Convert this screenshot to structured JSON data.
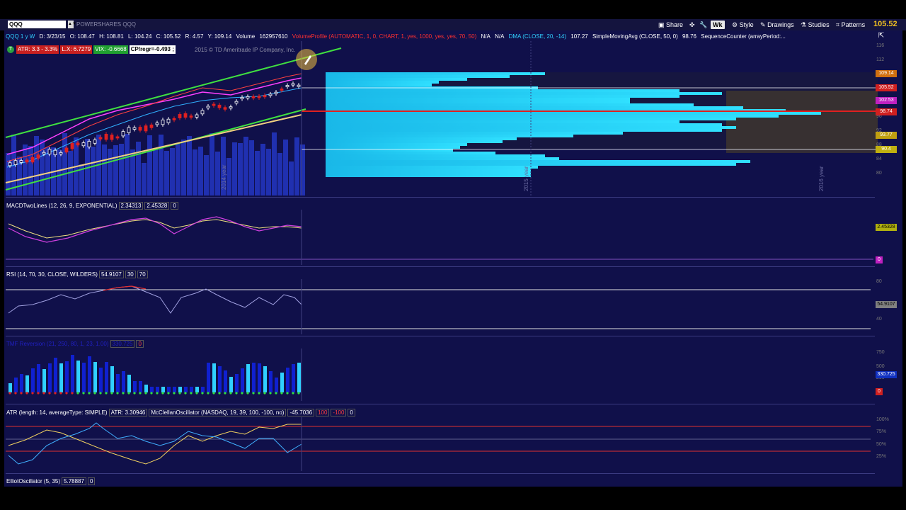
{
  "toolbar": {
    "symbol": "QQQ",
    "symbol_arrows": "▲▼",
    "description": "POWERSHARES QQQ",
    "share": "Share",
    "timeframe": "Wk",
    "style": "Style",
    "drawings": "Drawings",
    "studies": "Studies",
    "patterns": "Patterns",
    "last_price": "105.52"
  },
  "info": {
    "symbol_period": "QQQ 1 y W",
    "date": "D: 3/23/15",
    "open": "O: 108.47",
    "high": "H: 108.81",
    "low": "L: 104.24",
    "close": "C: 105.52",
    "range": "R: 4.57",
    "y": "Y: 109.14",
    "volume_label": "Volume",
    "volume": "162957610",
    "volume_profile": "VolumeProfile (AUTOMATIC, 1, 0, CHART, 1, yes, 1000, yes, yes, 70, 50)",
    "na1": "N/A",
    "na2": "N/A",
    "dma": "DMA (CLOSE, 20, -14)",
    "dma_val": "107.27",
    "sma": "SimpleMovingAvg (CLOSE, 50, 0)",
    "sma_val": "98.76",
    "seqcounter": "SequenceCounter (arrayPeriod:..."
  },
  "badges": {
    "icon": "T",
    "atr": "ATR: 3.3 - 3.3%",
    "lx": "L.X: 6.7279",
    "vix": "VIX: -0.6668",
    "cp": "CP/regr=-0.493 ;"
  },
  "copyright": "2015 © TD Ameritrade IP Company, Inc.",
  "year_labels": {
    "y2014": "2014 year",
    "y2015": "2015 year",
    "y2016": "2016 year"
  },
  "price_tags": [
    {
      "label": "109.14",
      "color": "#d07010"
    },
    {
      "label": "105.52",
      "color": "#d02020"
    },
    {
      "label": "102.53",
      "color": "#c020c0"
    },
    {
      "label": "98.74",
      "color": "#d02020"
    },
    {
      "label": "93.77",
      "color": "#c0a010"
    },
    {
      "label": "90.4",
      "color": "#c0b010"
    }
  ],
  "price_axis": [
    "116",
    "112",
    "108",
    "104",
    "100",
    "96",
    "92",
    "88",
    "84",
    "80"
  ],
  "macd": {
    "label": "MACDTwoLines (12, 26, 9, EXPONENTIAL)",
    "v1": "2.34313",
    "v2": "2.45328",
    "v3": "0",
    "tag1": "2.45328",
    "tag2": "0"
  },
  "rsi": {
    "label": "RSI (14, 70, 30, CLOSE, WILDERS)",
    "v1": "54.9107",
    "v2": "30",
    "v3": "70",
    "tag": "54.9107",
    "t80": "80",
    "t40": "40"
  },
  "tmf": {
    "label": "TMF Reversion (21, 250, 80, 1, 23, 1.00)",
    "v1": "330.725",
    "v2": "0",
    "tag1": "330.725",
    "tag2": "0",
    "t750": "750",
    "t500": "500",
    "t250": "250"
  },
  "atr_panel": {
    "label": "ATR (length: 14, averageType: SIMPLE)",
    "atr": "ATR: 3.30946",
    "mcl": "McClellanOscillator (NASDAQ, 19, 39, 100, -100, no)",
    "v1": "-45.7036",
    "v2": "100",
    "v3": "-100",
    "v4": "0",
    "p100": "100%",
    "p75": "75%",
    "p50": "50%",
    "p25": "25%"
  },
  "elliot": {
    "label": "ElliotOscillator (5, 35)",
    "v1": "5.78887",
    "v2": "0"
  },
  "colors": {
    "background": "#10104a",
    "toolbar": "#14143e",
    "volume_profile": "#20d0ff",
    "volume_bars": "#2030b0",
    "channel": "#40e040"
  }
}
